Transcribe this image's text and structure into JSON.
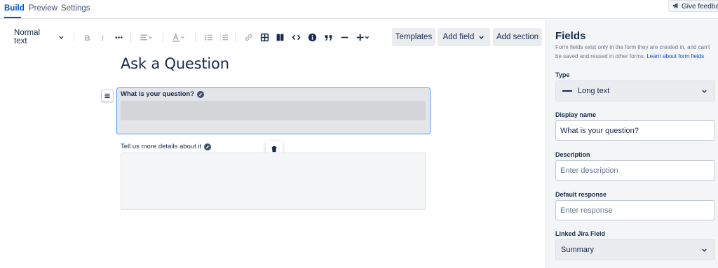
{
  "tabs": [
    {
      "label": "Build",
      "active": true
    },
    {
      "label": "Preview",
      "active": false
    },
    {
      "label": "Settings",
      "active": false
    }
  ],
  "feedback_label": "Give feedback",
  "toolbar": {
    "text_style": "Normal text",
    "templates_label": "Templates",
    "add_field_label": "Add field",
    "add_section_label": "Add section",
    "icons": [
      "bold-icon",
      "italic-icon",
      "more-formatting-icon",
      "alignment-icon",
      "text-color-icon",
      "bullet-list-icon",
      "numbered-list-icon",
      "link-icon",
      "table-icon",
      "layout-icon",
      "code-icon",
      "info-panel-icon",
      "quote-icon",
      "divider-icon",
      "insert-icon"
    ]
  },
  "form": {
    "title": "Ask a Question",
    "fields": [
      {
        "label": "What is your question?",
        "selected": true
      },
      {
        "label": "Tell us more details about it",
        "selected": false
      }
    ]
  },
  "panel": {
    "title": "Fields",
    "description": "Form fields exist only in the form they are created in, and can't be saved and reused in other forms.",
    "learn_link": "Learn about form fields",
    "type_label": "Type",
    "type_value": "Long text",
    "display_name_label": "Display name",
    "display_name_value": "What is your question?",
    "description_label": "Description",
    "description_placeholder": "Enter description",
    "default_response_label": "Default response",
    "default_response_placeholder": "Enter response",
    "linked_field_label": "Linked Jira Field",
    "linked_field_value": "Summary"
  },
  "colors": {
    "accent": "#0052cc",
    "selection_border": "#4c9aff",
    "panel_bg": "#f4f5f7"
  }
}
